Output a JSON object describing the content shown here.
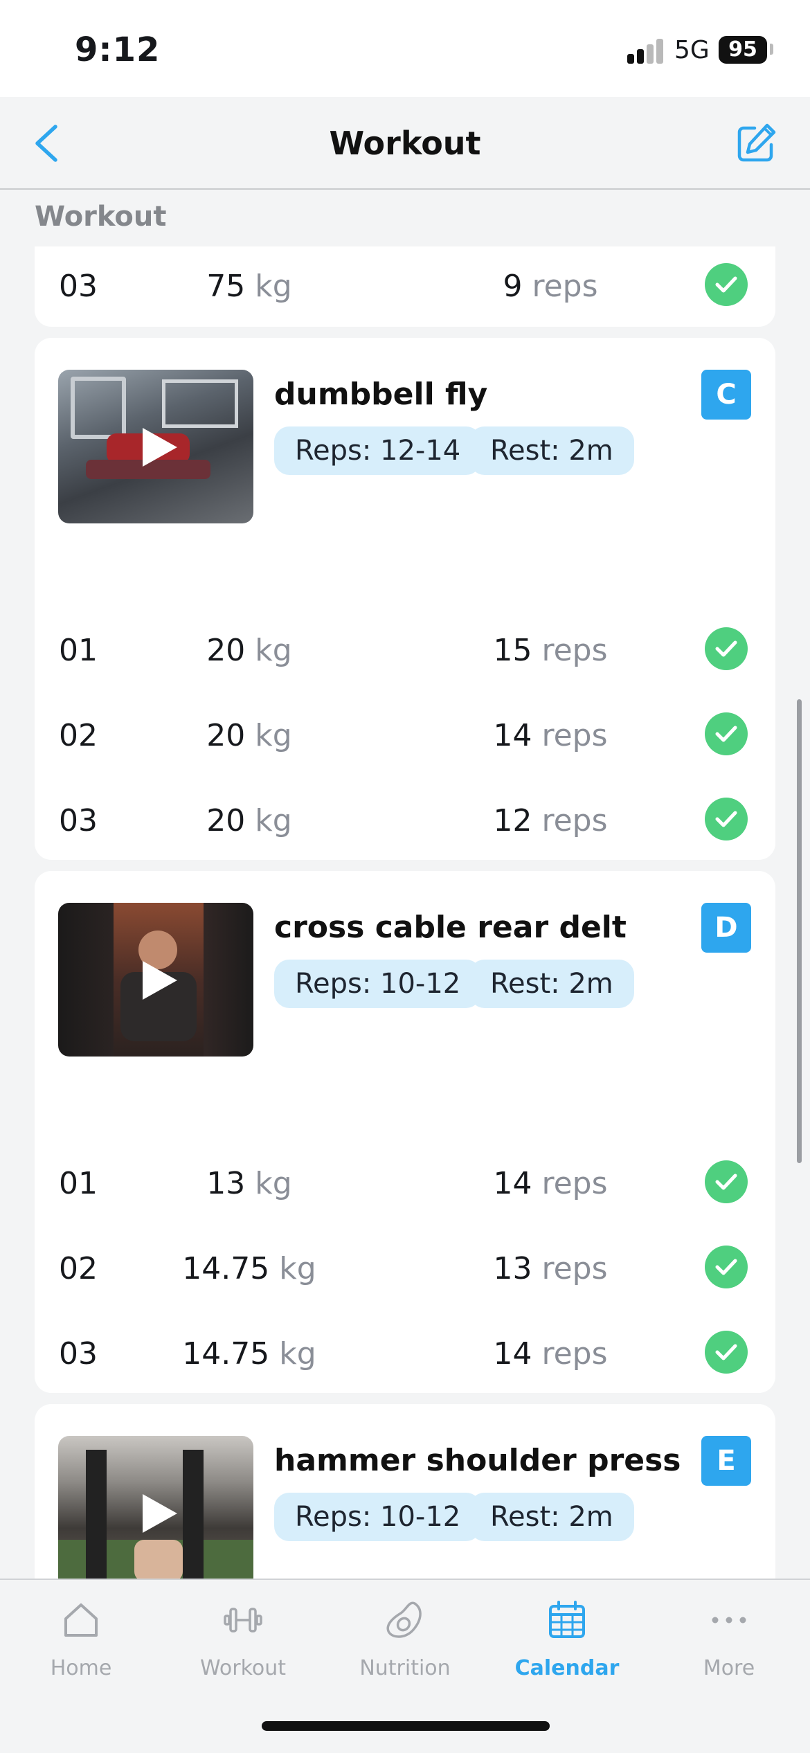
{
  "status_bar": {
    "time": "9:12",
    "network": "5G",
    "battery": "95"
  },
  "nav": {
    "title": "Workout"
  },
  "section_header": "Workout",
  "top_card": {
    "rows": [
      {
        "set": "03",
        "weight": "75",
        "weight_unit": "kg",
        "reps": "9",
        "reps_unit": "reps"
      }
    ]
  },
  "exercises": [
    {
      "name": "dumbbell fly",
      "reps_pill": "Reps: 12-14",
      "rest_pill": "Rest: 2m",
      "badge": "C",
      "rows": [
        {
          "set": "01",
          "weight": "20",
          "weight_unit": "kg",
          "reps": "15",
          "reps_unit": "reps"
        },
        {
          "set": "02",
          "weight": "20",
          "weight_unit": "kg",
          "reps": "14",
          "reps_unit": "reps"
        },
        {
          "set": "03",
          "weight": "20",
          "weight_unit": "kg",
          "reps": "12",
          "reps_unit": "reps"
        }
      ]
    },
    {
      "name": "cross cable rear delt",
      "reps_pill": "Reps: 10-12",
      "rest_pill": "Rest: 2m",
      "badge": "D",
      "rows": [
        {
          "set": "01",
          "weight": "13",
          "weight_unit": "kg",
          "reps": "14",
          "reps_unit": "reps"
        },
        {
          "set": "02",
          "weight": "14.75",
          "weight_unit": "kg",
          "reps": "13",
          "reps_unit": "reps"
        },
        {
          "set": "03",
          "weight": "14.75",
          "weight_unit": "kg",
          "reps": "14",
          "reps_unit": "reps"
        }
      ]
    },
    {
      "name": "hammer shoulder press",
      "reps_pill": "Reps: 10-12",
      "rest_pill": "Rest: 2m",
      "badge": "E",
      "rows": []
    }
  ],
  "tabs": [
    {
      "label": "Home",
      "icon": "home-icon",
      "active": false
    },
    {
      "label": "Workout",
      "icon": "dumbbell-icon",
      "active": false
    },
    {
      "label": "Nutrition",
      "icon": "avocado-icon",
      "active": false
    },
    {
      "label": "Calendar",
      "icon": "calendar-icon",
      "active": true
    },
    {
      "label": "More",
      "icon": "more-icon",
      "active": false
    }
  ],
  "colors": {
    "accent": "#2ea6ee",
    "check": "#4fcf7f",
    "pill_bg": "#d7eefb",
    "unit_text": "#8a8e97",
    "inactive_tab": "#a5a8ad"
  }
}
